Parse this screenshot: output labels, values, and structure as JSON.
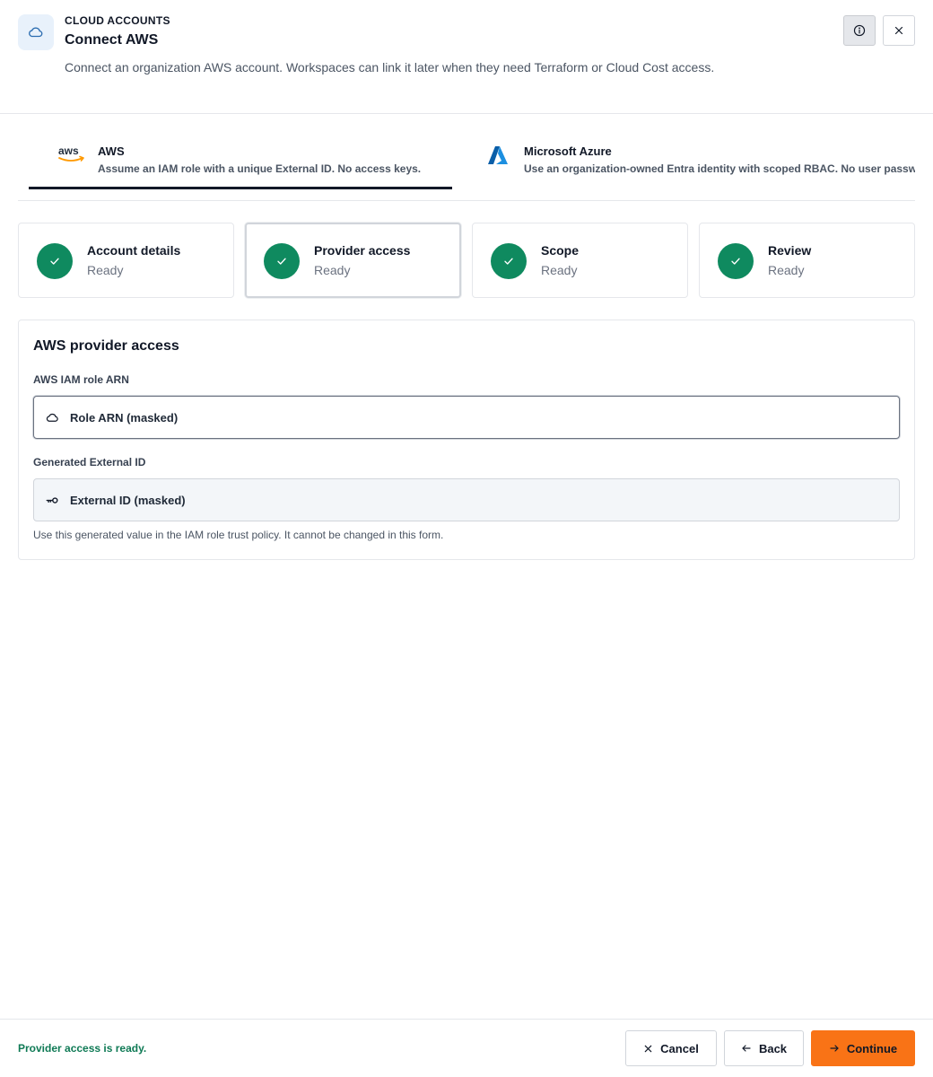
{
  "header": {
    "eyebrow": "CLOUD ACCOUNTS",
    "title": "Connect AWS",
    "description": "Connect an organization AWS account. Workspaces can link it later when they need Terraform or Cloud Cost access.",
    "header_icon": "cloud-icon",
    "info_icon": "info-icon",
    "close_icon": "close-icon"
  },
  "providers": [
    {
      "title": "AWS",
      "subtitle": "Assume an IAM role with a unique External ID. No access keys.",
      "logo_text": "aws",
      "selected": true
    },
    {
      "title": "Microsoft Azure",
      "subtitle": "Use an organization-owned Entra identity with scoped RBAC. No user passwords.",
      "selected": false
    }
  ],
  "steps": [
    {
      "title": "Account details",
      "status": "Ready",
      "active": false
    },
    {
      "title": "Provider access",
      "status": "Ready",
      "active": true
    },
    {
      "title": "Scope",
      "status": "Ready",
      "active": false
    },
    {
      "title": "Review",
      "status": "Ready",
      "active": false
    }
  ],
  "panel": {
    "title": "AWS provider access",
    "role_arn": {
      "label": "AWS IAM role ARN",
      "value": "Role ARN (masked)",
      "icon": "cloud-icon"
    },
    "external_id": {
      "label": "Generated External ID",
      "value": "External ID (masked)",
      "icon": "key-icon"
    },
    "help": "Use this generated value in the IAM role trust policy. It cannot be changed in this form."
  },
  "footer": {
    "status": "Provider access is ready.",
    "cancel_label": "Cancel",
    "back_label": "Back",
    "continue_label": "Continue"
  },
  "colors": {
    "accent": "#f97316",
    "success": "#0f8a5f",
    "status_text": "#0f7a55",
    "aws_orange": "#ff9900",
    "azure_blue": "#0078d4"
  }
}
